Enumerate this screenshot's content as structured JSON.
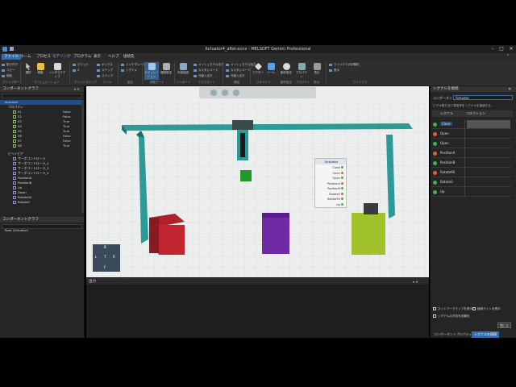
{
  "window": {
    "title": "Actuator4_after.ecnx - MELSOFT Gemini Professional"
  },
  "menu": [
    {
      "label": "ファイル",
      "active": true
    },
    {
      "label": "ホーム"
    },
    {
      "label": "プロセス"
    },
    {
      "label": "モデリング"
    },
    {
      "label": "プログラム"
    },
    {
      "label": "表示"
    },
    {
      "label": "ヘルプ"
    },
    {
      "label": "接続先"
    }
  ],
  "ribbon": {
    "groups": [
      "クリップボード",
      "マニピュレーション",
      "グリッドスナップ",
      "ツール",
      "固定",
      "移動モード",
      "インポート",
      "エクスポート",
      "構造",
      "ジオメトリ",
      "動作設定",
      "プロパティ",
      "表示",
      "ウインドウ"
    ],
    "buttons": [
      "選択",
      "移動",
      "インタラクティブ",
      "アニメーション",
      "インテグレーション",
      "シグナル",
      "エミュレーション",
      "連続設定",
      "外部接続",
      "アクター",
      "ツール",
      "ジオメトリ",
      "動作設定",
      "プロパティ",
      "表示",
      "ウィンドウ"
    ],
    "small": [
      "貼り付け",
      "コピー",
      "削除",
      "グリッド",
      "Z",
      "ボックス",
      "ステップ",
      "スナップ",
      "メッシュモデル出力",
      "カスタムコード",
      "外部入出力",
      "ウインドウの初期化",
      "表示"
    ]
  },
  "left_panel": {
    "title": "コンポーネントグラフ",
    "root": "Actuator",
    "properties_label": "プロパティ",
    "properties": [
      {
        "name": "S1",
        "value": "False"
      },
      {
        "name": "S2",
        "value": "False"
      },
      {
        "name": "S3",
        "value": "True"
      },
      {
        "name": "S4",
        "value": "True"
      },
      {
        "name": "S5",
        "value": "True"
      },
      {
        "name": "S6",
        "value": "False"
      },
      {
        "name": "S7",
        "value": "False"
      },
      {
        "name": "S8",
        "value": "True"
      }
    ],
    "signals_label": "ビヘイビア",
    "signals": [
      "サーボコントローラ",
      "サーボコントローラ_2",
      "サーボコントローラ_3",
      "サーボコントローラ_4",
      "PositionA",
      "PositionB",
      "Up",
      "Down",
      "Rotate90",
      "Rotate0"
    ],
    "second_title": "コンポーネントグラフ",
    "second_root": "Root (Actuator)"
  },
  "viewport": {
    "popup_title": "Actuator",
    "popup_signals": [
      {
        "name": "Close",
        "color": "#3db54a"
      },
      {
        "name": "Open",
        "color": "#e0603a"
      },
      {
        "name": "Open",
        "color": "#3db54a"
      },
      {
        "name": "PositionA",
        "color": "#e0603a"
      },
      {
        "name": "PositionB",
        "color": "#3db54a"
      },
      {
        "name": "Rotate0",
        "color": "#e0603a"
      },
      {
        "name": "Rotate90",
        "color": "#3db54a"
      },
      {
        "name": "Up",
        "color": "#3db54a"
      }
    ],
    "nav_labels": [
      "B",
      "L",
      "T",
      "R",
      "F"
    ]
  },
  "output": {
    "title": "出力"
  },
  "right_panel": {
    "title": "シグナルを接続",
    "component_label": "コンポーネント",
    "component_value": "Actuator",
    "hint": "ビデオ割り当て済信号をシグナルを接続する",
    "col_signal": "シグナル",
    "col_connection": "コネクション",
    "rows": [
      {
        "label": "Close",
        "color": "#3db54a",
        "selected": true
      },
      {
        "label": "Open",
        "color": "#e0603a"
      },
      {
        "label": "Open",
        "color": "#3db54a"
      },
      {
        "label": "PositionA",
        "color": "#e0603a"
      },
      {
        "label": "PositionB",
        "color": "#3db54a"
      },
      {
        "label": "Rotate90",
        "color": "#e0603a"
      },
      {
        "label": "Rotate0",
        "color": "#3db54a"
      },
      {
        "label": "Up",
        "color": "#3db54a"
      }
    ],
    "checks": [
      "ネットワークマップを表示",
      "接続ラインを表示",
      "シグナルの方向を自動化"
    ],
    "close_label": "閉じる",
    "tabs": [
      "コンポーネントプロパティ",
      "シグナルを接続"
    ]
  }
}
